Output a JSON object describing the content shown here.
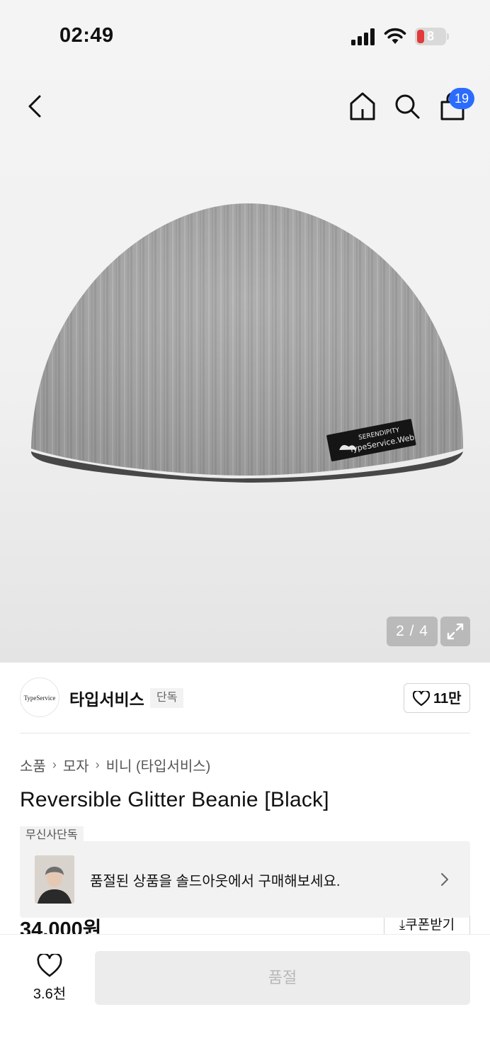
{
  "status_bar": {
    "time": "02:49",
    "battery_level": "8"
  },
  "nav": {
    "cart_count": "19"
  },
  "gallery": {
    "pager": "2 / 4",
    "product_label_line1": "SERENDIPITY",
    "product_label_line2": "TypeService.Web"
  },
  "brand": {
    "logo_text": "TypeService",
    "name": "타입서비스",
    "tag": "단독",
    "likes": "11만"
  },
  "breadcrumb": [
    "소품",
    "모자",
    "비니 (타입서비스)"
  ],
  "product": {
    "title": "Reversible Glitter Beanie [Black]",
    "exclusive_tag": "무신사단독",
    "price": "34,000원",
    "coupon_label": "쿠폰받기"
  },
  "soldout_banner": {
    "text": "품절된 상품을 솔드아웃에서 구매해보세요."
  },
  "bottom_bar": {
    "wish_count": "3.6천",
    "buy_label": "품절"
  },
  "colors": {
    "accent": "#2b6cff",
    "battery_low": "#e23a3a",
    "disabled_bg": "#ececec"
  }
}
